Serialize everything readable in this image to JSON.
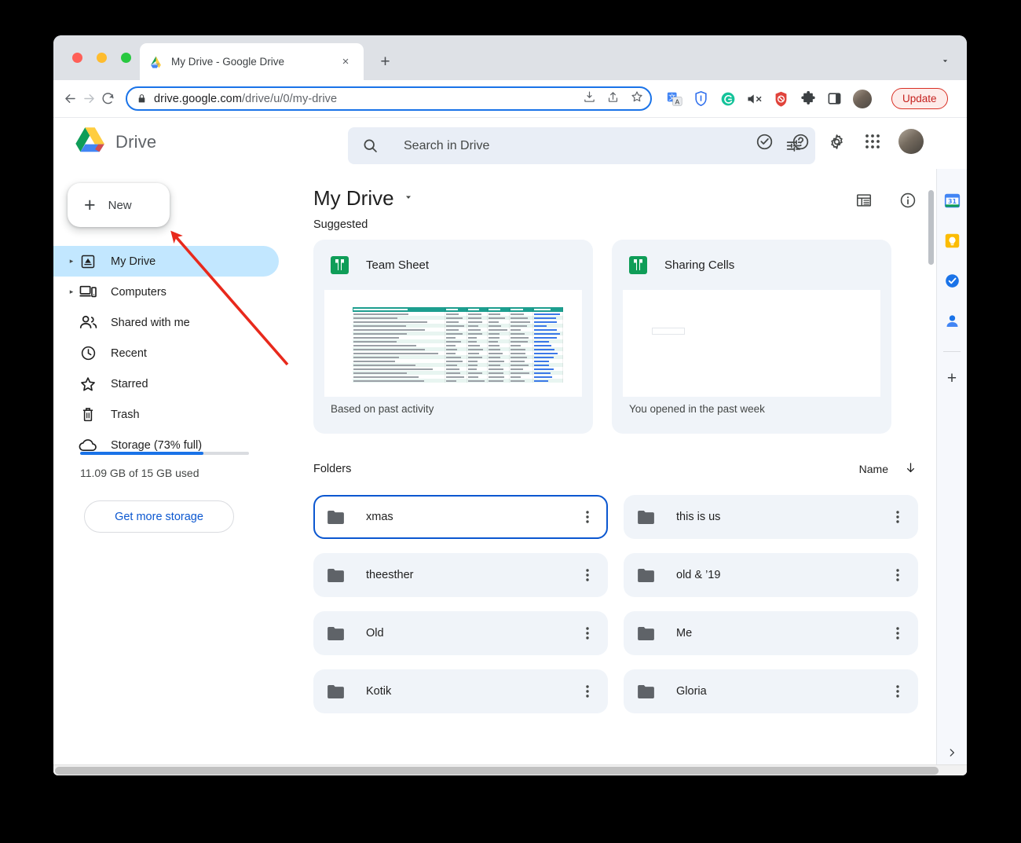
{
  "browser": {
    "tab": {
      "title": "My Drive - Google Drive",
      "favicon": "google-drive-icon",
      "close": "×"
    },
    "new_tab_label": "+",
    "tab_list_chevron": "chevron-down-icon",
    "nav": {
      "back": "back-arrow-icon",
      "forward": "forward-arrow-icon",
      "reload": "reload-icon"
    },
    "omnibox": {
      "lock": "lock-icon",
      "url_domain": "drive.google.com",
      "url_path": "/drive/u/0/my-drive",
      "download_icon": "download-icon",
      "share_icon": "share-icon",
      "bookmark_icon": "star-icon"
    },
    "extensions": [
      {
        "name": "google-translate-icon"
      },
      {
        "name": "vpn-shield-icon"
      },
      {
        "name": "grammarly-icon"
      },
      {
        "name": "mute-tab-icon"
      },
      {
        "name": "adblock-icon"
      },
      {
        "name": "extensions-puzzle-icon"
      },
      {
        "name": "side-panel-icon"
      }
    ],
    "profile_avatar": "user-avatar",
    "update_button": "Update",
    "menu_kebab": "chrome-menu-icon"
  },
  "drive": {
    "brand": {
      "logo": "google-drive-logo",
      "word": "Drive"
    },
    "new_button": {
      "plus": "+",
      "label": "New"
    },
    "sidebar": {
      "items": [
        {
          "label": "My Drive",
          "icon": "my-drive-icon",
          "caret": "▸",
          "active": true
        },
        {
          "label": "Computers",
          "icon": "computers-icon",
          "caret": "▸",
          "active": false
        },
        {
          "label": "Shared with me",
          "icon": "people-icon",
          "caret": "",
          "active": false
        },
        {
          "label": "Recent",
          "icon": "clock-icon",
          "caret": "",
          "active": false
        },
        {
          "label": "Starred",
          "icon": "star-outline-icon",
          "caret": "",
          "active": false
        },
        {
          "label": "Trash",
          "icon": "trash-icon",
          "caret": "",
          "active": false
        },
        {
          "label": "Storage (73% full)",
          "icon": "cloud-icon",
          "caret": "",
          "active": false
        }
      ],
      "storage_percent": 73,
      "storage_text": "11.09 GB of 15 GB used",
      "get_more_storage": "Get more storage"
    },
    "search": {
      "placeholder": "Search in Drive",
      "search_icon": "search-icon",
      "filter_icon": "search-options-icon"
    },
    "header_icons": [
      {
        "name": "support-check-icon"
      },
      {
        "name": "help-icon"
      },
      {
        "name": "settings-gear-icon"
      },
      {
        "name": "google-apps-grid-icon"
      }
    ],
    "page_title": "My Drive",
    "page_title_caret": "▾",
    "view_icons": [
      {
        "name": "list-view-icon"
      },
      {
        "name": "details-info-icon"
      }
    ],
    "suggested_label": "Suggested",
    "suggested": [
      {
        "title": "Team Sheet",
        "icon": "google-sheets-icon",
        "reason": "Based on past activity",
        "thumb": "spreadsheet-preview"
      },
      {
        "title": "Sharing Cells",
        "icon": "google-sheets-icon",
        "reason": "You opened in the past week",
        "thumb": "blank-sheet-preview"
      }
    ],
    "folders_label": "Folders",
    "sort": {
      "label": "Name",
      "direction_icon": "arrow-down-icon"
    },
    "folders": [
      {
        "name": "xmas",
        "selected": true
      },
      {
        "name": "this is us",
        "selected": false
      },
      {
        "name": "theesther",
        "selected": false
      },
      {
        "name": "old & ’19",
        "selected": false
      },
      {
        "name": "Old",
        "selected": false
      },
      {
        "name": "Me",
        "selected": false
      },
      {
        "name": "Kotik",
        "selected": false
      },
      {
        "name": "Gloria",
        "selected": false
      }
    ],
    "right_rail": {
      "apps": [
        {
          "name": "google-calendar-icon"
        },
        {
          "name": "google-keep-icon"
        },
        {
          "name": "google-tasks-icon"
        },
        {
          "name": "google-contacts-icon"
        }
      ],
      "add_app": "+",
      "expand_chevron": "chevron-right-icon"
    }
  },
  "annotation": {
    "arrow_color": "#e8291c",
    "points_to": "new-button"
  },
  "colors": {
    "accent_blue": "#0b57d0",
    "selected_nav": "#c2e7ff",
    "card_bg": "#f0f4f9",
    "search_bg": "#e9eef6",
    "sheets_green": "#0f9d58",
    "update_red": "#c5221f"
  }
}
